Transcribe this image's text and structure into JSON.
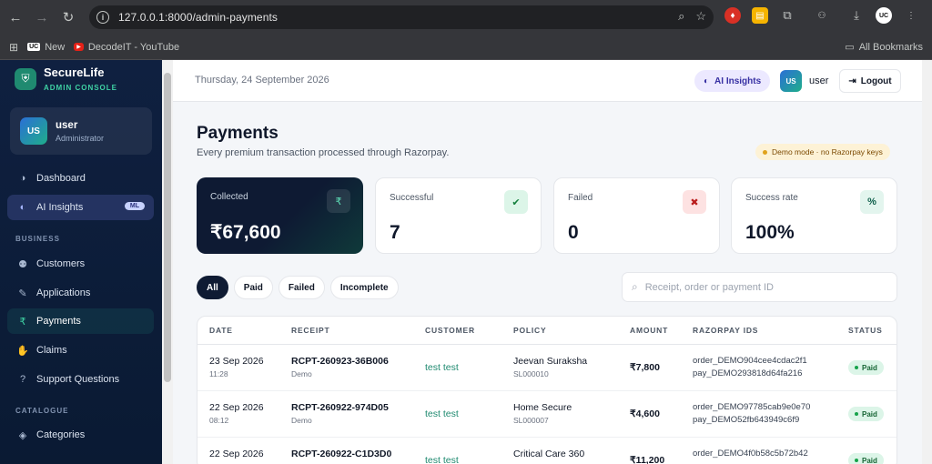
{
  "browser": {
    "url": "127.0.0.1:8000/admin-payments",
    "bookmarks": [
      {
        "label": "New"
      },
      {
        "label": "DecodeIT - YouTube"
      }
    ],
    "all_bookmarks": "All Bookmarks"
  },
  "sidebar": {
    "brand": "SecureLife",
    "brand_sub": "ADMIN CONSOLE",
    "user": {
      "initials": "US",
      "name": "user",
      "role": "Administrator"
    },
    "items": [
      {
        "label": "Dashboard"
      },
      {
        "label": "AI Insights",
        "badge": "ML"
      },
      {
        "label": "Customers"
      },
      {
        "label": "Applications"
      },
      {
        "label": "Payments"
      },
      {
        "label": "Claims"
      },
      {
        "label": "Support Questions"
      },
      {
        "label": "Categories"
      }
    ],
    "sections": {
      "business": "BUSINESS",
      "catalogue": "CATALOGUE"
    }
  },
  "topbar": {
    "date": "Thursday, 24 September 2026",
    "ai_label": "AI Insights",
    "avatar": "US",
    "user": "user",
    "logout": "Logout"
  },
  "page": {
    "title": "Payments",
    "subtitle": "Every premium transaction processed through Razorpay.",
    "demo_badge": "Demo mode · no Razorpay keys"
  },
  "stats": [
    {
      "label": "Collected",
      "value": "₹67,600",
      "icon": "₹"
    },
    {
      "label": "Successful",
      "value": "7",
      "icon": "✔"
    },
    {
      "label": "Failed",
      "value": "0",
      "icon": "✖"
    },
    {
      "label": "Success rate",
      "value": "100%",
      "icon": "%"
    }
  ],
  "filters": [
    "All",
    "Paid",
    "Failed",
    "Incomplete"
  ],
  "search": {
    "placeholder": "Receipt, order or payment ID"
  },
  "table": {
    "headers": [
      "DATE",
      "RECEIPT",
      "CUSTOMER",
      "POLICY",
      "AMOUNT",
      "RAZORPAY IDS",
      "STATUS"
    ],
    "rows": [
      {
        "date": "23 Sep 2026",
        "time": "11:28",
        "receipt": "RCPT-260923-36B006",
        "mode": "Demo",
        "customer": "test test",
        "policy": "Jeevan Suraksha",
        "policy_id": "SL000010",
        "amount": "₹7,800",
        "order_id": "order_DEMO904cee4cdac2f1",
        "pay_id": "pay_DEMO293818d64fa216",
        "status": "Paid"
      },
      {
        "date": "22 Sep 2026",
        "time": "08:12",
        "receipt": "RCPT-260922-974D05",
        "mode": "Demo",
        "customer": "test test",
        "policy": "Home Secure",
        "policy_id": "SL000007",
        "amount": "₹4,600",
        "order_id": "order_DEMO97785cab9e0e70",
        "pay_id": "pay_DEMO52fb643949c6f9",
        "status": "Paid"
      },
      {
        "date": "22 Sep 2026",
        "time": "",
        "receipt": "RCPT-260922-C1D3D0",
        "mode": "",
        "customer": "test test",
        "policy": "Critical Care 360",
        "policy_id": "",
        "amount": "₹11,200",
        "order_id": "order_DEMO4f0b58c5b72b42",
        "pay_id": "",
        "status": "Paid"
      }
    ]
  },
  "colors": {
    "accent": "#1f8a70",
    "dark": "#0f1b33",
    "ai": "#3730a3"
  }
}
